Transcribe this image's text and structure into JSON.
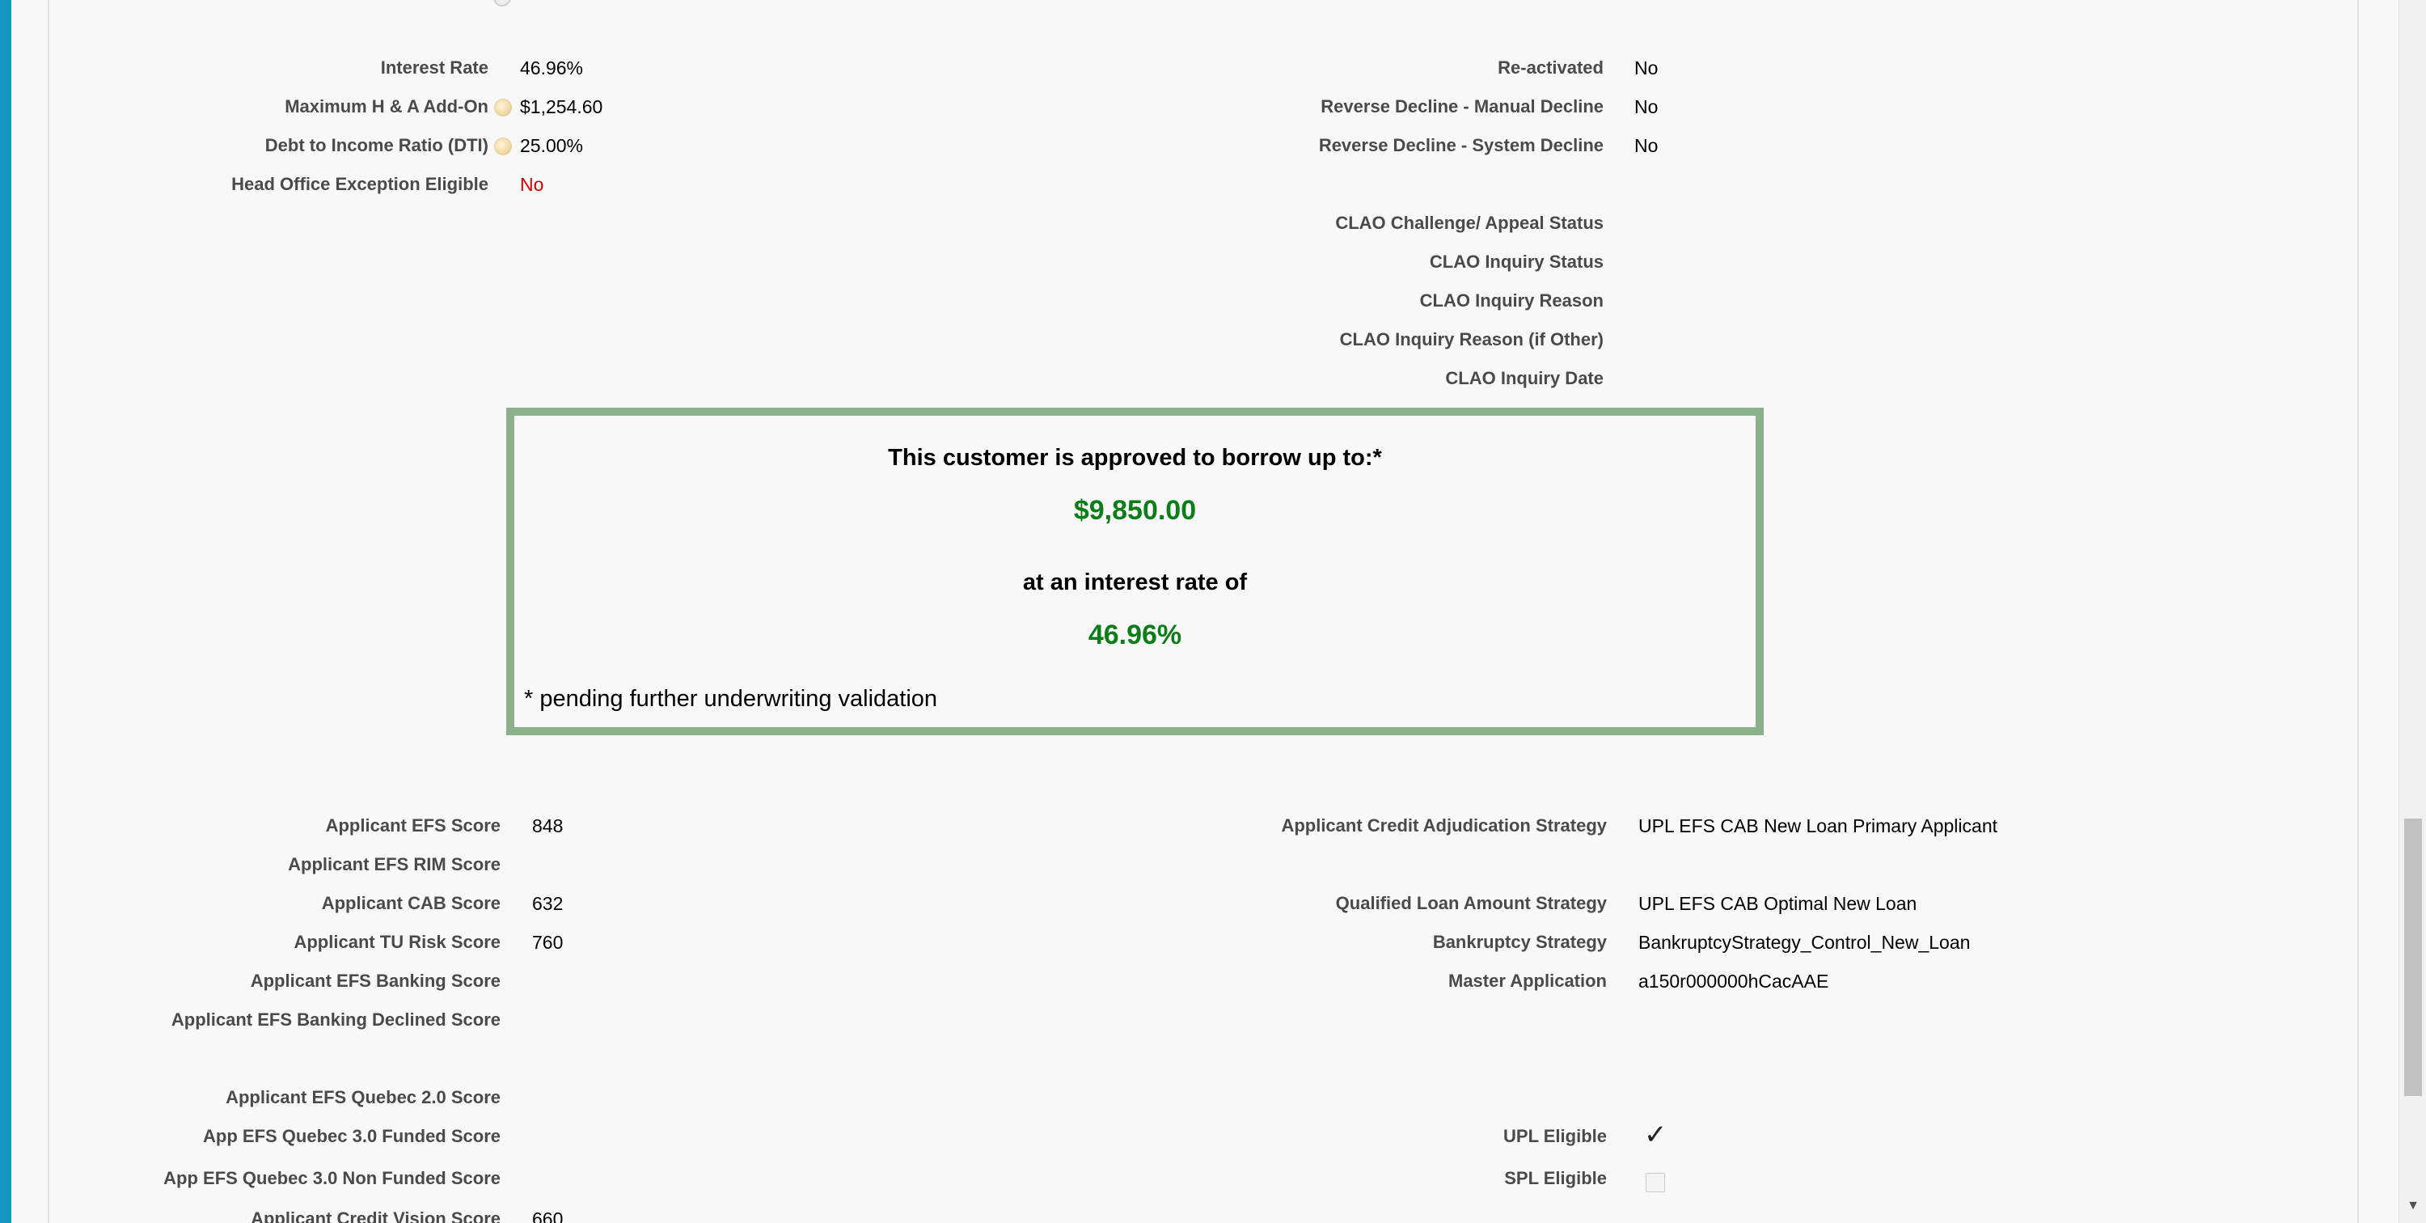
{
  "top_section": {
    "left": [
      {
        "label": "Interest Rate",
        "value": "46.96%"
      },
      {
        "label": "Maximum H & A Add-On",
        "value": "$1,254.60"
      },
      {
        "label": "Debt to Income Ratio (DTI)",
        "value": "25.00%"
      },
      {
        "label": "Head Office Exception Eligible",
        "value": "No"
      }
    ],
    "right": [
      {
        "label": "Re-activated",
        "value": "No"
      },
      {
        "label": "Reverse Decline - Manual Decline",
        "value": "No"
      },
      {
        "label": "Reverse Decline - System Decline",
        "value": "No"
      },
      {
        "label": "CLAO Challenge/ Appeal Status",
        "value": ""
      },
      {
        "label": "CLAO Inquiry Status",
        "value": ""
      },
      {
        "label": "CLAO Inquiry Reason",
        "value": ""
      },
      {
        "label": "CLAO Inquiry Reason (if Other)",
        "value": ""
      },
      {
        "label": "CLAO Inquiry Date",
        "value": ""
      }
    ]
  },
  "approval": {
    "heading": "This customer is approved to borrow up to:*",
    "amount": "$9,850.00",
    "rate_heading": "at an interest rate of",
    "rate": "46.96%",
    "footnote": "* pending further underwriting validation"
  },
  "scores_section": {
    "left": [
      {
        "label": "Applicant EFS Score",
        "value": "848"
      },
      {
        "label": "Applicant EFS RIM Score",
        "value": ""
      },
      {
        "label": "Applicant CAB Score",
        "value": "632"
      },
      {
        "label": "Applicant TU Risk Score",
        "value": "760"
      },
      {
        "label": "Applicant EFS Banking Score",
        "value": ""
      },
      {
        "label": "Applicant EFS Banking Declined Score",
        "value": ""
      },
      {
        "label": "Applicant EFS Quebec 2.0 Score",
        "value": ""
      },
      {
        "label": "App EFS Quebec 3.0 Funded Score",
        "value": ""
      },
      {
        "label": "App EFS Quebec 3.0 Non Funded Score",
        "value": ""
      },
      {
        "label": "Applicant Credit Vision Score",
        "value": "660"
      }
    ],
    "right": [
      {
        "label": "Applicant Credit Adjudication Strategy",
        "value": "UPL EFS CAB New Loan Primary Applicant"
      },
      {
        "label": "Qualified Loan Amount Strategy",
        "value": "UPL EFS CAB Optimal New Loan"
      },
      {
        "label": "Bankruptcy Strategy",
        "value": "BankruptcyStrategy_Control_New_Loan"
      },
      {
        "label": "Master Application",
        "value": "a150r000000hCacAAE"
      },
      {
        "label": "UPL Eligible",
        "value": "✓"
      },
      {
        "label": "SPL Eligible",
        "value": ""
      }
    ]
  },
  "colors": {
    "approval_border": "#8cb08a",
    "approval_amount": "#0d7d1a",
    "no_value_red": "#d00000",
    "left_accent": "#1797c0"
  }
}
